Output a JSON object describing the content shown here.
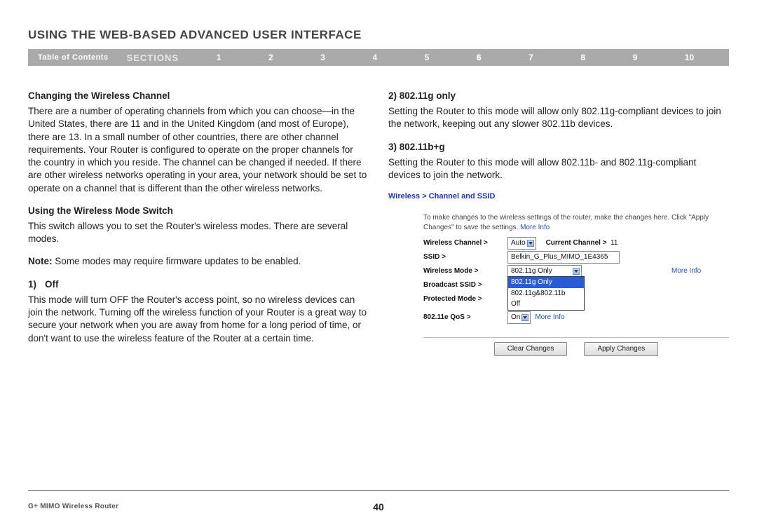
{
  "title": "USING THE WEB-BASED ADVANCED USER INTERFACE",
  "nav": {
    "toc": "Table of Contents",
    "sections": "SECTIONS",
    "items": [
      "1",
      "2",
      "3",
      "4",
      "5",
      "6",
      "7",
      "8",
      "9",
      "10"
    ],
    "current": "6"
  },
  "left": {
    "h1": "Changing the Wireless Channel",
    "p1": "There are a number of operating channels from which you can choose—in the United States, there are 11 and in the United Kingdom (and most of Europe), there are 13. In a small number of other countries, there are other channel requirements. Your Router is configured to operate on the proper channels for the country in which you reside. The channel can be changed if needed. If there are other wireless networks operating in your area, your network should be set to operate on a channel that is different than the other wireless networks.",
    "h2": "Using the Wireless Mode Switch",
    "p2": "This switch allows you to set the Router's wireless modes. There are several modes.",
    "note_label": "Note:",
    "note_text": " Some modes may require firmware updates to be enabled.",
    "opt1_num": "1)",
    "opt1_label": "Off",
    "p3": "This mode will turn OFF the Router's access point, so no wireless devices can join the network. Turning off the wireless function of your Router is a great way to secure your network when you are away from home for a long period of time, or don't want to use the wireless feature of the Router at a certain time."
  },
  "right": {
    "opt2": "2) 802.11g only",
    "p2": "Setting the Router to this mode will allow only 802.11g-compliant devices to join the network, keeping out any slower 802.11b devices.",
    "opt3": "3) 802.11b+g",
    "p3": "Setting the Router to this mode will allow 802.11b- and 802.11g-compliant devices to join the network."
  },
  "ui": {
    "breadcrumb": "Wireless > Channel and SSID",
    "desc_pre": "To make changes to the wireless settings of the router, make the changes here. Click \"Apply Changes\" to save the settings. ",
    "more": "More Info",
    "rows": {
      "channel_label": "Wireless Channel >",
      "channel_value": "Auto",
      "curr_label": "Current Channel >",
      "curr_value": "11",
      "ssid_label": "SSID >",
      "ssid_value": "Belkin_G_Plus_MIMO_1E4365",
      "mode_label": "Wireless Mode >",
      "mode_value": "802.11g Only",
      "broadcast_label": "Broadcast SSID >",
      "protected_label": "Protected Mode >",
      "qos_label": "802.11e QoS >",
      "qos_value": "On"
    },
    "dropdown": [
      "802.11g Only",
      "802.11g&802.11b",
      "Off"
    ],
    "buttons": {
      "clear": "Clear Changes",
      "apply": "Apply Changes"
    }
  },
  "footer": {
    "model": "G+ MIMO Wireless Router",
    "page": "40"
  }
}
